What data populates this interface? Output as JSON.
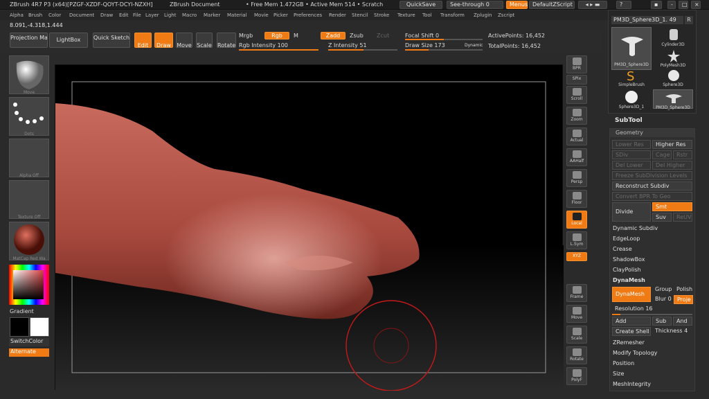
{
  "title": {
    "app": "ZBrush 4R7 P3 (x64)[PZGF-XZDF-QOYT-DCYI-NZXH]",
    "doc": "ZBrush Document",
    "mem": "• Free Mem 1.472GB • Active Mem 514 • Scratch",
    "quicksave": "QuickSave",
    "seethrough": "See-through  0",
    "menus": "Menus",
    "script": "DefaultZScript"
  },
  "menu": [
    "Alpha",
    "Brush",
    "Color",
    "Document",
    "Draw",
    "Edit",
    "File",
    "Layer",
    "Light",
    "Macro",
    "Marker",
    "Material",
    "Movie",
    "Picker",
    "Preferences",
    "Render",
    "Stencil",
    "Stroke",
    "Texture",
    "Tool",
    "Transform",
    "Zplugin",
    "Zscript"
  ],
  "coords": "8.091,-4.318,1.444",
  "shelf": {
    "projection_master": "Projection Master",
    "lightbox": "LightBox",
    "quick_sketch": "Quick Sketch",
    "edit": "Edit",
    "draw": "Draw",
    "move": "Move",
    "scale": "Scale",
    "rotate": "Rotate",
    "mrgb": "Mrgb",
    "rgb": "Rgb",
    "m": "M",
    "rgb_intensity": "Rgb Intensity 100",
    "zadd": "Zadd",
    "zsub": "Zsub",
    "zcut": "Zcut",
    "z_intensity": "Z Intensity 51",
    "focal_shift": "Focal Shift 0",
    "draw_size": "Draw Size 173",
    "dynamic": "Dynamic",
    "active_points": "ActivePoints: 16,452",
    "total_points": "TotalPoints: 16,452"
  },
  "left": {
    "move": "Move",
    "dots": "Dots",
    "alpha_off": "Alpha Off",
    "texture_off": "Texture Off",
    "matcap": "MatCap Red Wa",
    "gradient": "Gradient",
    "switchcolor": "SwitchColor",
    "alternate": "Alternate"
  },
  "rightbar": [
    "BPR",
    "SPix",
    "Scroll",
    "Zoom",
    "Actual",
    "AAHalf",
    "Persp",
    "Floor",
    "Local",
    "L.Sym",
    "XYZ",
    "Frame",
    "Move",
    "Scale",
    "Rotate",
    "PolyF"
  ],
  "tools": {
    "current": "PM3D_Sphere3D_1. 49",
    "r": "R",
    "items": [
      "PM3D_Sphere3D",
      "Cylinder3D",
      "SimpleBrush",
      "PolyMesh3D",
      "Sphere3D_1",
      "Sphere3D",
      "PM3D_Sphere3D"
    ]
  },
  "subtool": "SubTool",
  "geometry": {
    "header": "Geometry",
    "lower_res": "Lower Res",
    "higher_res": "Higher Res",
    "sdiv": "SDiv",
    "cage": "Cage",
    "rstr": "Rstr",
    "del_lower": "Del Lower",
    "del_higher": "Del Higher",
    "freeze": "Freeze SubDivision Levels",
    "reconstruct": "Reconstruct Subdiv",
    "convert": "Convert BPR To Geo",
    "divide": "Divide",
    "smt": "Smt",
    "suv": "Suv",
    "reuv": "ReUV",
    "dynamic_subdiv": "Dynamic Subdiv",
    "edgeloop": "EdgeLoop",
    "crease": "Crease",
    "shadowbox": "ShadowBox",
    "claypolish": "ClayPolish",
    "dynamesh_header": "DynaMesh",
    "dynamesh_btn": "DynaMesh",
    "group": "Group",
    "polish": "Polish",
    "blur": "Blur 0",
    "project": "Proje",
    "resolution": "Resolution 16",
    "add": "Add",
    "sub": "Sub",
    "and": "And",
    "create_shell": "Create Shell",
    "thickness": "Thickness 4",
    "zremesher": "ZRemesher",
    "modify_topology": "Modify Topology",
    "position": "Position",
    "size": "Size",
    "meshintegrity": "MeshIntegrity"
  },
  "colors": {
    "accent": "#f07a14",
    "bg": "#2a2a2a",
    "canvas": "#000000",
    "mesh": "#b5564a"
  }
}
